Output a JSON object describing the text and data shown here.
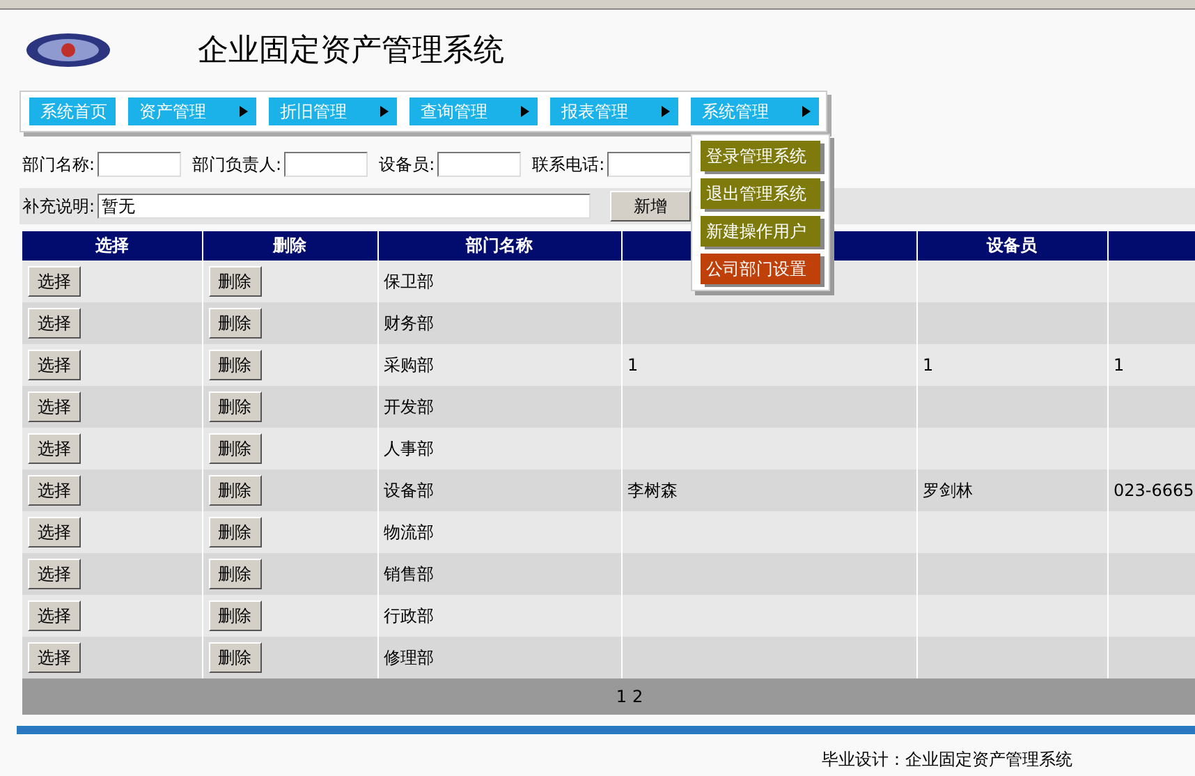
{
  "header": {
    "title": "企业固定资产管理系统"
  },
  "menu": [
    {
      "label": "系统首页",
      "has_submenu": false
    },
    {
      "label": "资产管理",
      "has_submenu": true
    },
    {
      "label": "折旧管理",
      "has_submenu": true
    },
    {
      "label": "查询管理",
      "has_submenu": true
    },
    {
      "label": "报表管理",
      "has_submenu": true
    },
    {
      "label": "系统管理",
      "has_submenu": true,
      "submenu": [
        {
          "label": "登录管理系统",
          "selected": false
        },
        {
          "label": "退出管理系统",
          "selected": false
        },
        {
          "label": "新建操作用户",
          "selected": false
        },
        {
          "label": "公司部门设置",
          "selected": true
        }
      ]
    }
  ],
  "form": {
    "fields": [
      {
        "label": "部门名称:"
      },
      {
        "label": "部门负责人:"
      },
      {
        "label": "设备员:"
      },
      {
        "label": "联系电话:"
      }
    ],
    "note": {
      "label": "补充说明:",
      "value": "暂无"
    },
    "add_button": "新增"
  },
  "table": {
    "columns": [
      "选择",
      "删除",
      "部门名称",
      null,
      "设备员",
      null
    ],
    "rows": [
      {
        "select": "选择",
        "delete": "删除",
        "department": "保卫部"
      },
      {
        "select": "选择",
        "delete": "删除",
        "department": "财务部"
      },
      {
        "select": "选择",
        "delete": "删除",
        "department": "采购部",
        "column_4": "1",
        "equipment_officer": "1",
        "column_6": "1"
      },
      {
        "select": "选择",
        "delete": "删除",
        "department": "开发部"
      },
      {
        "select": "选择",
        "delete": "删除",
        "department": "人事部"
      },
      {
        "select": "选择",
        "delete": "删除",
        "department": "设备部",
        "column_4": "李树森",
        "equipment_officer": "罗剑林",
        "column_6": "023-6665"
      },
      {
        "select": "选择",
        "delete": "删除",
        "department": "物流部"
      },
      {
        "select": "选择",
        "delete": "删除",
        "department": "销售部"
      },
      {
        "select": "选择",
        "delete": "删除",
        "department": "行政部"
      },
      {
        "select": "选择",
        "delete": "删除",
        "department": "修理部"
      }
    ],
    "pager": [
      "1",
      "2"
    ]
  },
  "footer": "毕业设计：企业固定资产管理系统"
}
